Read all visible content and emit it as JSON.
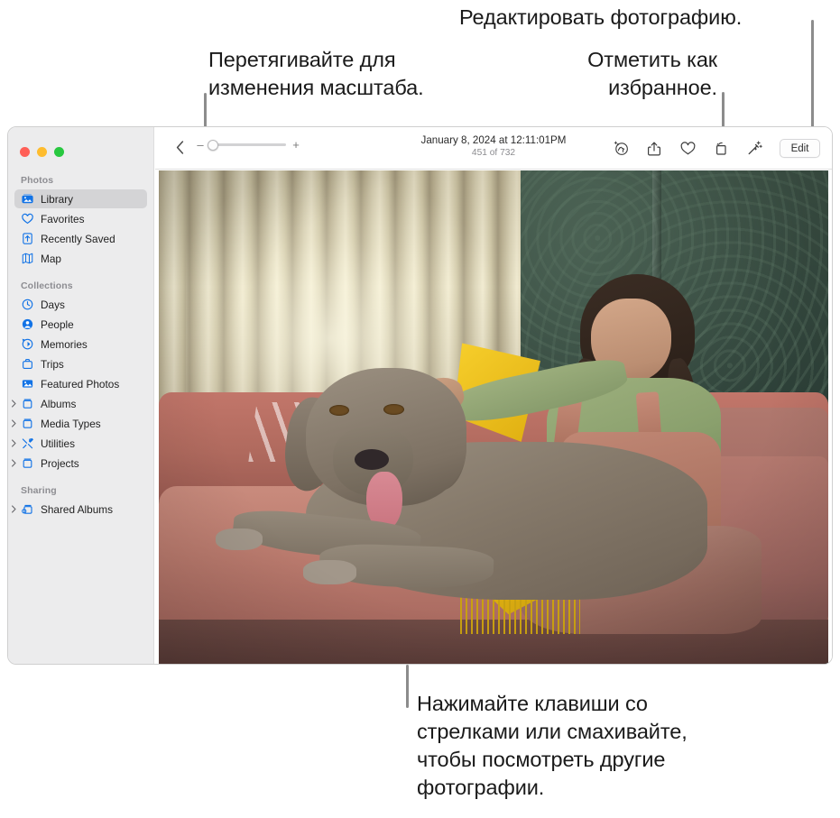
{
  "callouts": {
    "edit_photo": "Редактировать фотографию.",
    "zoom_drag": "Перетягивайте для\nизменения масштаба.",
    "mark_favorite": "Отметить как\nизбранное.",
    "arrow_keys": "Нажимайте клавиши со\nстрелками или смахивайте,\nчтобы посмотреть другие\nфотографии."
  },
  "window": {
    "traffic_lights": {
      "close": "close-button",
      "minimize": "minimize-button",
      "maximize": "maximize-button"
    }
  },
  "sidebar": {
    "sections": [
      {
        "title": "Photos",
        "items": [
          {
            "label": "Library",
            "icon": "library-icon",
            "selected": true,
            "disclosure": false
          },
          {
            "label": "Favorites",
            "icon": "heart-icon",
            "selected": false,
            "disclosure": false
          },
          {
            "label": "Recently Saved",
            "icon": "recently-saved-icon",
            "selected": false,
            "disclosure": false
          },
          {
            "label": "Map",
            "icon": "map-icon",
            "selected": false,
            "disclosure": false
          }
        ]
      },
      {
        "title": "Collections",
        "items": [
          {
            "label": "Days",
            "icon": "clock-icon",
            "selected": false,
            "disclosure": false
          },
          {
            "label": "People",
            "icon": "person-icon",
            "selected": false,
            "disclosure": false
          },
          {
            "label": "Memories",
            "icon": "memories-icon",
            "selected": false,
            "disclosure": false
          },
          {
            "label": "Trips",
            "icon": "suitcase-icon",
            "selected": false,
            "disclosure": false
          },
          {
            "label": "Featured Photos",
            "icon": "featured-photos-icon",
            "selected": false,
            "disclosure": false
          },
          {
            "label": "Albums",
            "icon": "album-icon",
            "selected": false,
            "disclosure": true
          },
          {
            "label": "Media Types",
            "icon": "album-icon",
            "selected": false,
            "disclosure": true
          },
          {
            "label": "Utilities",
            "icon": "utilities-icon",
            "selected": false,
            "disclosure": true
          },
          {
            "label": "Projects",
            "icon": "album-icon",
            "selected": false,
            "disclosure": true
          }
        ]
      },
      {
        "title": "Sharing",
        "items": [
          {
            "label": "Shared Albums",
            "icon": "shared-album-icon",
            "selected": false,
            "disclosure": true
          }
        ]
      }
    ]
  },
  "toolbar": {
    "back_icon": "back-chevron-icon",
    "zoom": {
      "minus": "–",
      "plus": "+",
      "value_percent": 3
    },
    "photo_date": "January 8, 2024 at 12:11:01PM",
    "photo_count": "451 of 732",
    "actions": [
      {
        "name": "visual-look-up-icon"
      },
      {
        "name": "share-icon"
      },
      {
        "name": "favorite-heart-icon"
      },
      {
        "name": "rotate-icon"
      },
      {
        "name": "auto-enhance-icon"
      }
    ],
    "edit_label": "Edit"
  },
  "colors": {
    "accent": "#1273e6",
    "sidebar_bg": "#ececed",
    "selected_row": "#d4d4d6",
    "traffic_red": "#ff5f57",
    "traffic_yellow": "#febc2e",
    "traffic_green": "#28c840",
    "leader_line": "#8c8c8c"
  }
}
